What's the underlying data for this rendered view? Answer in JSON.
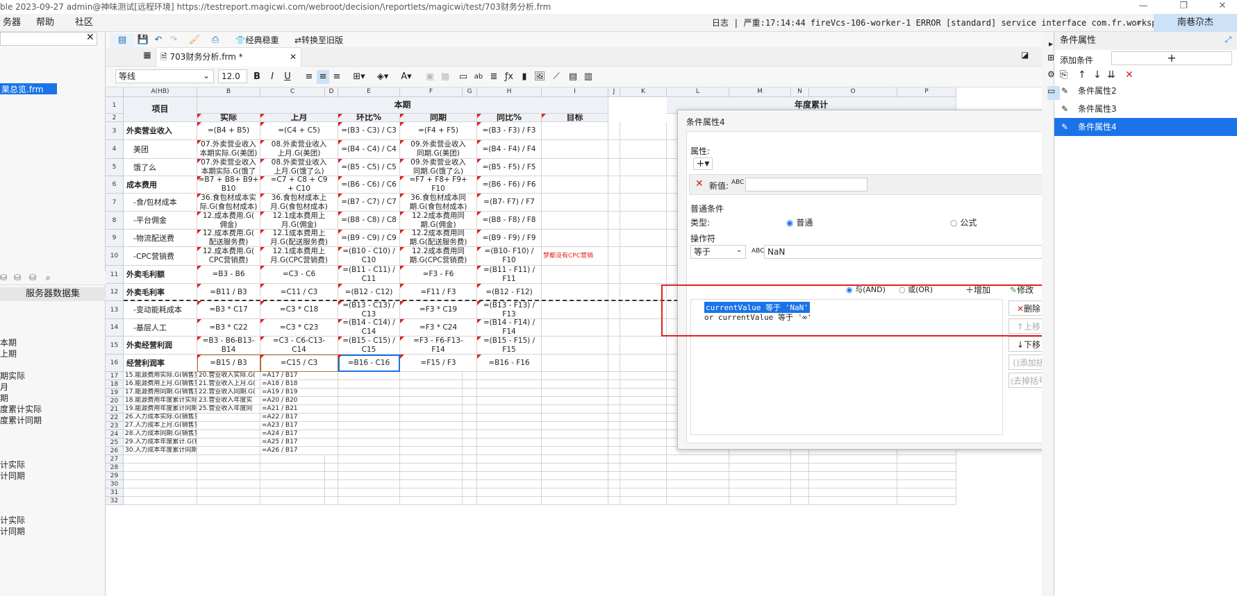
{
  "titlebar": {
    "text": "ble 2023-09-27 admin@神味测试[远程环境]   https://testreport.magicwi.com/webroot/decision/\\reportlets/magicwi/test/703财务分析.frm"
  },
  "menu": {
    "items": [
      "务器",
      "帮助",
      "社区"
    ],
    "log": "日志 | 严重:17:14:44 fireVcs-106-worker-1 ERROR [standard] service interface com.fr.workspace.ser...",
    "user": "南巷尕杰"
  },
  "left": {
    "file": "果总览.frm",
    "tab": "服务器数据集",
    "items": [
      "本期",
      "上期",
      "期实际",
      "月",
      "期",
      "度累计实际",
      "度累计同期",
      "计实际",
      "计同期",
      "计实际",
      "计同期"
    ]
  },
  "toolbar": {
    "classic": "经典稳重",
    "convert": "转换至旧版"
  },
  "tab": {
    "title": "703财务分析.frm *"
  },
  "format": {
    "style": "等线",
    "size": "12.0",
    "bold": "B",
    "italic": "I",
    "underline": "U"
  },
  "grid": {
    "cols": [
      "A(HB)",
      "B",
      "C",
      "D",
      "E",
      "F",
      "G",
      "H",
      "I",
      "J",
      "K",
      "L",
      "M",
      "N",
      "O",
      "P"
    ],
    "header": {
      "item": "项目",
      "period": "本期",
      "ytd": "年度累计",
      "actual": "实际",
      "last": "上月",
      "hb": "环比%",
      "tq": "同期",
      "tb": "同比%",
      "target": "目标"
    },
    "rows": [
      [
        "外卖营业收入",
        "=(B4 + B5)",
        "=(C4 + C5)",
        "=(B3 - C3) / C3",
        "=(F4 + F5)",
        "=(B3 - F3) / F3"
      ],
      [
        "美团",
        "07.外卖营业收入\n本期实际.G(美团)",
        "08.外卖营业收入\n上月.G(美团)",
        "=(B4 - C4) / C4",
        "09.外卖营业收入\n同期.G(美团)",
        "=(B4 - F4) / F4"
      ],
      [
        "饿了么",
        "07.外卖营业收入\n本期实际.G(饿了",
        "08.外卖营业收入\n上月.G(饿了么)",
        "=(B5 - C5) / C5",
        "09.外卖营业收入\n同期.G(饿了么)",
        "=(B5 - F5) / F5"
      ],
      [
        "成本费用",
        "=B7 + B8+ B9+\nB10",
        "=C7 + C8 + C9\n+ C10",
        "=(B6 - C6) / C6",
        "=F7 + F8+ F9+\nF10",
        "=(B6 - F6) / F6"
      ],
      [
        "-食/包材成本",
        "36.食包材成本实\n际.G(食包材成本)",
        "36.食包材成本上\n月.G(食包材成本)",
        "=(B7 - C7) / C7",
        "36.食包材成本同\n期.G(食包材成本)",
        "=(B7- F7) / F7"
      ],
      [
        "-平台佣金",
        "12.成本费用.G(\n佣金)",
        "12.1成本费用上\n月.G(佣金)",
        "=(B8 - C8) / C8",
        "12.2成本费用同\n期.G(佣金)",
        "=(B8 - F8) / F8"
      ],
      [
        "-物流配送费",
        "12.成本费用.G(\n配送服务费)",
        "12.1成本费用上\n月.G(配送服务费)",
        "=(B9 - C9) / C9",
        "12.2成本费用同\n期.G(配送服务费)",
        "=(B9 - F9) / F9"
      ],
      [
        "-CPC营销费",
        "12.成本费用.G(\nCPC营销费)",
        "12.1成本费用上\n月.G(CPC营销费)",
        "=(B10 - C10) /\nC10",
        "12.2成本费用同\n期.G(CPC营销费)",
        "=(B10- F10) /\nF10"
      ],
      [
        "外卖毛利额",
        "=B3 - B6",
        "=C3 - C6",
        "=(B11 - C11) /\nC11",
        "=F3 - F6",
        "=(B11 - F11) /\nF11"
      ],
      [
        "外卖毛利率",
        "=B11 / B3",
        "=C11 / C3",
        "=(B12 - C12)",
        "=F11 / F3",
        "=(B12 - F12)"
      ],
      [
        "-变动能耗成本",
        "=B3 * C17",
        "=C3 * C18",
        "=(B13 - C13) /\nC13",
        "=F3 * C19",
        "=(B13 - F13) /\nF13"
      ],
      [
        "-基层人工",
        "=B3 * C22",
        "=C3 * C23",
        "=(B14 - C14) /\nC14",
        "=F3 * C24",
        "=(B14 - F14) /\nF14"
      ],
      [
        "外卖经营利润",
        "=B3 - B6-B13-\nB14",
        "=C3 - C6-C13-\nC14",
        "=(B15 - C15) /\nC15",
        "=F3 - F6-F13-\nF14",
        "=(B15 - F15) /\nF15"
      ],
      [
        "经营利润率",
        "=B15 / B3",
        "=C15 / C3",
        "=B16 - C16",
        "=F15 / F3",
        "=B16 - F16"
      ]
    ],
    "annot": "梦都没有CPC营销",
    "small": [
      [
        "15.能源费用实际.G(销售变动",
        "20.营业收入实际.G(",
        "=A17 / B17"
      ],
      [
        "16.能源费用上月.G(销售变动",
        "21.营业收入上月.G(",
        "=A18 / B18"
      ],
      [
        "17.能源费用同期.G(销售变动",
        "22.营业收入同期.G(",
        "=A19 / B19"
      ],
      [
        "18.能源费用年度累计实际.G(",
        "23.营业收入年度实",
        "=A20 / B20"
      ],
      [
        "19.能源费用年度累计同期.G(",
        "25.营业收入年度同",
        "=A21 / B21"
      ],
      [
        "26.人力成本实际.G(销售变动",
        "",
        "=A22 / B17"
      ],
      [
        "27.人力成本上月.G(销售变动",
        "",
        "=A23 / B17"
      ],
      [
        "28.人力成本同期.G(销售变动",
        "",
        "=A24 / B17"
      ],
      [
        "29.人力成本年度累计.G(销售",
        "",
        "=A25 / B17"
      ],
      [
        "30.人力成本年度累计同期.G(",
        "",
        "=A26 / B17"
      ]
    ]
  },
  "dialog": {
    "title": "条件属性4",
    "attr": "属性:",
    "newval": "新值:",
    "common": "普通条件",
    "type": "类型:",
    "normal": "普通",
    "formula": "公式",
    "op": "操作符",
    "op_val": "等于",
    "val": "NaN",
    "and": "与(AND)",
    "or": "或(OR)",
    "add": "增加",
    "modify": "修改",
    "cond1": "currentValue 等于 'NaN'",
    "cond2": "or  currentValue 等于 '∞'",
    "del": "删除",
    "up": "上移",
    "down": "下移",
    "addp": "添加括号",
    "remp": "去掉括号"
  },
  "right": {
    "title": "条件属性",
    "add": "添加条件",
    "items": [
      "条件属性2",
      "条件属性3",
      "条件属性4"
    ]
  }
}
